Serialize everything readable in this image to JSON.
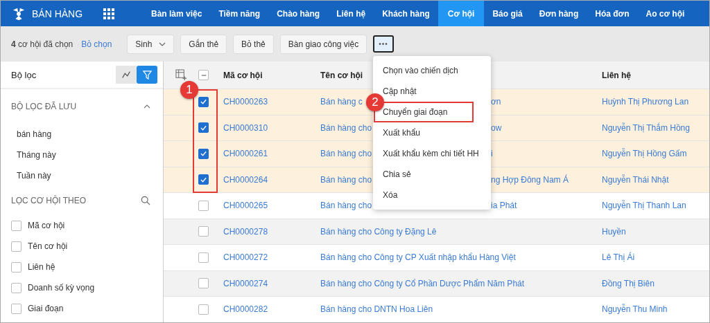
{
  "app": {
    "title": "BÁN HÀNG"
  },
  "nav": [
    {
      "label": "Bàn làm việc",
      "selected": false
    },
    {
      "label": "Tiềm năng",
      "selected": false
    },
    {
      "label": "Chào hàng",
      "selected": false
    },
    {
      "label": "Liên hệ",
      "selected": false
    },
    {
      "label": "Khách hàng",
      "selected": false
    },
    {
      "label": "Cơ hội",
      "selected": true
    },
    {
      "label": "Báo giá",
      "selected": false
    },
    {
      "label": "Đơn hàng",
      "selected": false
    },
    {
      "label": "Hóa đơn",
      "selected": false
    },
    {
      "label": "Ao cơ hội",
      "selected": false
    }
  ],
  "toolbar": {
    "count": "4",
    "count_text": "cơ hội đã chọn",
    "clear": "Bỏ chọn",
    "buttons": [
      {
        "label": "Sinh",
        "kind": "dropdown"
      },
      {
        "label": "Gắn thẻ",
        "kind": "button"
      },
      {
        "label": "Bỏ thẻ",
        "kind": "button"
      },
      {
        "label": "Bàn giao công việc",
        "kind": "button"
      },
      {
        "label": "•••",
        "kind": "more"
      }
    ]
  },
  "sidebar": {
    "title": "Bộ lọc",
    "view_toggle": [
      {
        "kind": "chart",
        "selected": false
      },
      {
        "kind": "filter",
        "selected": true
      }
    ],
    "saved": {
      "title": "BỘ LỌC ĐÃ LƯU",
      "expanded": true,
      "items": [
        "bán hàng",
        "Tháng này",
        "Tuần này"
      ]
    },
    "filter_by": {
      "title": "LỌC CƠ HỘI THEO",
      "fields": [
        {
          "label": "Mã cơ hội",
          "checked": false
        },
        {
          "label": "Tên cơ hội",
          "checked": false
        },
        {
          "label": "Liên hệ",
          "checked": false
        },
        {
          "label": "Doanh số kỳ vọng",
          "checked": false
        },
        {
          "label": "Giai đoạn",
          "checked": false
        }
      ]
    }
  },
  "table": {
    "select_all": {
      "indeterminate": true
    },
    "columns": [
      "Mã cơ hội",
      "Tên cơ hội",
      "Liên hệ"
    ],
    "rows": [
      {
        "code": "CH0000263",
        "name": "Bán hàng c",
        "name_tail": "ơn",
        "contact": "Huỳnh Thị Phương Lan",
        "selected": true
      },
      {
        "code": "CH0000310",
        "name": "Bán hàng cho",
        "name_tail": "ow",
        "contact": "Nguyễn Thị Thắm Hồng",
        "selected": true
      },
      {
        "code": "CH0000261",
        "name": "Bán hàng cho",
        "name_tail": "i",
        "contact": "Nguyễn Thị Hồng Gấm",
        "selected": true
      },
      {
        "code": "CH0000264",
        "name": "Bán hàng cho",
        "name_tail": "ng Hợp Đông Nam Á",
        "contact": "Nguyễn Thái Nhật",
        "selected": true
      },
      {
        "code": "CH0000265",
        "name": "Bán hàng cho",
        "name_tail": "ia Phát",
        "contact": "Nguyễn Thị Thanh Lan",
        "selected": false
      },
      {
        "code": "CH0000278",
        "name": "Bán hàng cho Công ty Đặng Lê",
        "contact": "Huyền",
        "selected": false
      },
      {
        "code": "CH0000272",
        "name": "Bán hàng cho Công ty CP Xuất nhập khẩu Hàng Việt",
        "contact": "Lê Thị Ái",
        "selected": false
      },
      {
        "code": "CH0000274",
        "name": "Bán hàng cho Công ty Cổ Phần Dược Phẩm Năm Phát",
        "contact": "Đồng Thị Biên",
        "selected": false
      },
      {
        "code": "CH0000282",
        "name": "Bán hàng cho DNTN Hoa Liên",
        "contact": "Nguyễn Thu Minh",
        "selected": false
      }
    ]
  },
  "menu": {
    "items": [
      {
        "label": "Chọn vào chiến dịch",
        "highlighted": false
      },
      {
        "label": "Cập nhật",
        "highlighted": false
      },
      {
        "label": "Chuyển giai đoạn",
        "highlighted": true
      },
      {
        "label": "Xuất khẩu",
        "highlighted": false
      },
      {
        "label": "Xuất khẩu kèm chi tiết HH",
        "highlighted": false
      },
      {
        "label": "Chia sẻ",
        "highlighted": false
      },
      {
        "label": "Xóa",
        "highlighted": false
      }
    ]
  },
  "annotations": [
    "1",
    "2"
  ]
}
